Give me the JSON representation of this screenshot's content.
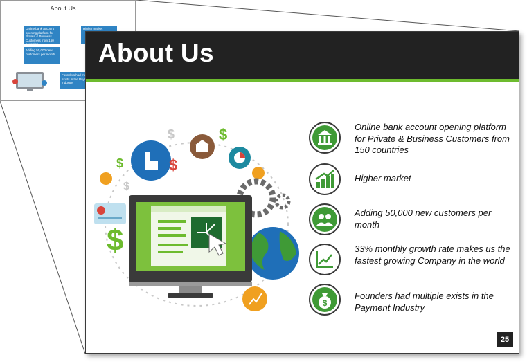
{
  "thumbnail": {
    "title": "About Us",
    "items": [
      "Online bank account opening platform for Private & Business Customers from 150 countries",
      "Higher market",
      "Adding 50,000 new customers per month",
      "Founders had multiple exists in the Payment Industry"
    ]
  },
  "slide": {
    "title": "About Us",
    "page_number": "25",
    "features": [
      {
        "icon": "bank-icon",
        "text": "Online bank account opening platform for Private & Business Customers from 150 countries"
      },
      {
        "icon": "growth-chart-icon",
        "text": "Higher market"
      },
      {
        "icon": "users-icon",
        "text": "Adding 50,000 new customers per month"
      },
      {
        "icon": "line-chart-icon",
        "text": "33% monthly growth rate makes us the fastest growing Company in the world"
      },
      {
        "icon": "money-bag-icon",
        "text": "Founders had multiple exists in the Payment Industry"
      }
    ]
  },
  "colors": {
    "accent": "#6dbb2e",
    "header": "#222222",
    "icon_green": "#3f9a36",
    "thumb_blue": "#2f84c4"
  }
}
